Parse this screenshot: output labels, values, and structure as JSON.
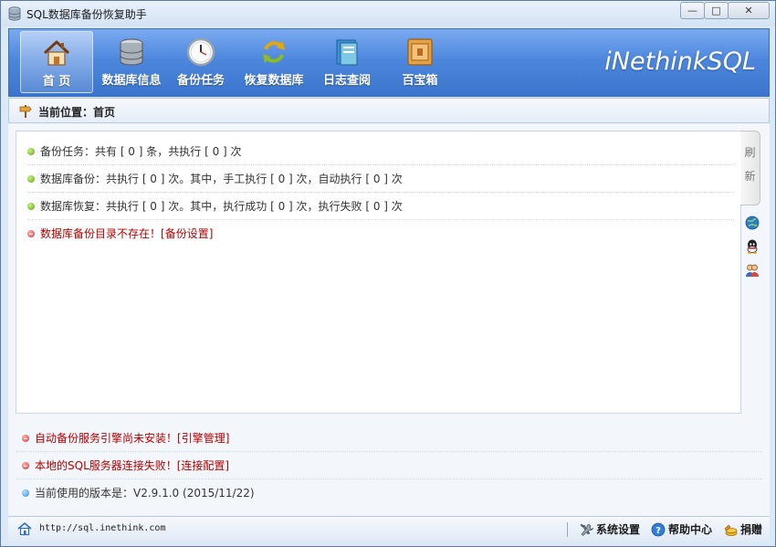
{
  "window": {
    "title": "SQL数据库备份恢复助手",
    "minimize_label": "—",
    "maximize_label": "□",
    "close_label": "✕"
  },
  "toolbar": {
    "brand": "iNethinkSQL",
    "items": [
      {
        "label": "首 页",
        "icon": "home-icon"
      },
      {
        "label": "数据库信息",
        "icon": "database-icon"
      },
      {
        "label": "备份任务",
        "icon": "clock-icon"
      },
      {
        "label": "恢复数据库",
        "icon": "refresh-icon"
      },
      {
        "label": "日志查阅",
        "icon": "book-icon"
      },
      {
        "label": "百宝箱",
        "icon": "box-icon"
      }
    ]
  },
  "breadcrumb": {
    "text": "当前位置：首页"
  },
  "summary": {
    "rows": [
      {
        "text": "备份任务：共有 [ 0 ] 条，共执行 [ 0 ] 次",
        "status": "ok"
      },
      {
        "text": "数据库备份：共执行 [ 0 ] 次。其中，手工执行 [ 0 ] 次，自动执行 [ 0 ] 次",
        "status": "ok"
      },
      {
        "text": "数据库恢复：共执行 [ 0 ] 次。其中，执行成功 [ 0 ] 次，执行失败 [ 0 ] 次",
        "status": "ok"
      },
      {
        "text": "数据库备份目录不存在！",
        "link": "[备份设置]",
        "status": "error"
      }
    ]
  },
  "side": {
    "refresh_label": "刷新",
    "icons": [
      "globe-icon",
      "qq-icon",
      "users-icon"
    ]
  },
  "notices": [
    {
      "text": "自动备份服务引擎尚未安装！",
      "link": "[引擎管理]",
      "status": "error"
    },
    {
      "text": "本地的SQL服务器连接失败！",
      "link": "[连接配置]",
      "status": "error"
    },
    {
      "text": "当前使用的版本是：V2.9.1.0 (2015/11/22)",
      "status": "info"
    }
  ],
  "statusbar": {
    "url": "http://sql.inethink.com",
    "settings_label": "系统设置",
    "help_label": "帮助中心",
    "donate_label": "捐赠"
  },
  "colors": {
    "toolbar_blue": "#4d87dd",
    "error_red": "#b30000",
    "ok_green": "#5aa51a"
  }
}
